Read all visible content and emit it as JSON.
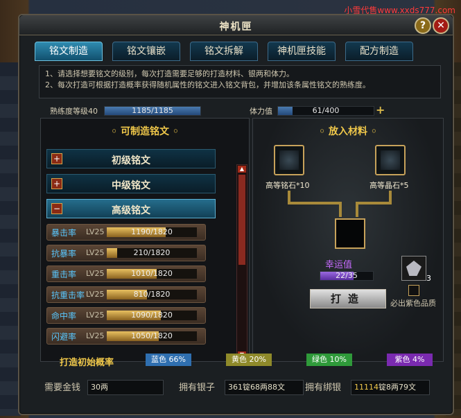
{
  "watermark": "小雪代售www.xxds777.com",
  "window": {
    "title": "神机匣"
  },
  "tabs": [
    "铭文制造",
    "铭文镶嵌",
    "铭文拆解",
    "神机匣技能",
    "配方制造"
  ],
  "info": [
    "1、请选择想要铭文的级别，每次打造需要足够的打造材料、银两和体力。",
    "2、每次打造可根据打造概率获得随机属性的铭文进入铭文背包，并增加该条属性铭文的熟练度。"
  ],
  "proficiency": {
    "label": "熟练度等级40",
    "value": "1185/1185",
    "ratio": 1.0
  },
  "stamina": {
    "label": "体力值",
    "value": "61/400",
    "ratio": 0.1525
  },
  "left_panel": {
    "title": "可制造铭文",
    "categories": [
      "初级铭文",
      "中级铭文",
      "高级铭文"
    ],
    "items": [
      {
        "name": "暴击率",
        "level": "LV25",
        "value": "1190/1820",
        "ratio": 0.654
      },
      {
        "name": "抗暴率",
        "level": "LV25",
        "value": "210/1820",
        "ratio": 0.115
      },
      {
        "name": "重击率",
        "level": "LV25",
        "value": "1010/1820",
        "ratio": 0.555
      },
      {
        "name": "抗重击率",
        "level": "LV25",
        "value": "810/1820",
        "ratio": 0.445
      },
      {
        "name": "命中率",
        "level": "LV25",
        "value": "1090/1820",
        "ratio": 0.599
      },
      {
        "name": "闪避率",
        "level": "LV25",
        "value": "1050/1820",
        "ratio": 0.577
      }
    ]
  },
  "right_panel": {
    "title": "放入材料",
    "materials": [
      "高等铭石*10",
      "高等晶石*5"
    ],
    "luck_label": "幸运值",
    "luck_value": "22/35",
    "luck_ratio": 0.6286,
    "stone_count": "3",
    "forge_button": "打造",
    "purple_check_label": "必出紫色品质"
  },
  "probability": {
    "label": "打造初始概率",
    "entries": [
      {
        "text": "蓝色 66%",
        "color": "#2f6fb0"
      },
      {
        "text": "黄色 20%",
        "color": "#8f8a2a"
      },
      {
        "text": "绿色 10%",
        "color": "#2f9a3a"
      },
      {
        "text": "紫色 4%",
        "color": "#7a2ab0"
      }
    ]
  },
  "footer": {
    "gold_label": "需要金钱",
    "gold_value": "30两",
    "silver_label": "拥有银子",
    "silver_value": "361锭68两88文",
    "bound_label": "拥有绑银",
    "bound_value_hi": "11114",
    "bound_value_rest": "锭8两79文"
  }
}
